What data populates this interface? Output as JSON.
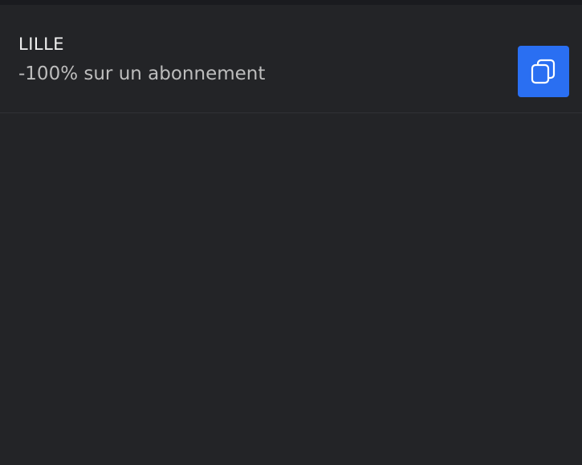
{
  "coupon": {
    "code": "LILLE",
    "description": "-100% sur un abonnement",
    "copy_icon": "copy-icon"
  },
  "colors": {
    "background": "#232427",
    "accent": "#2a6ff2"
  }
}
